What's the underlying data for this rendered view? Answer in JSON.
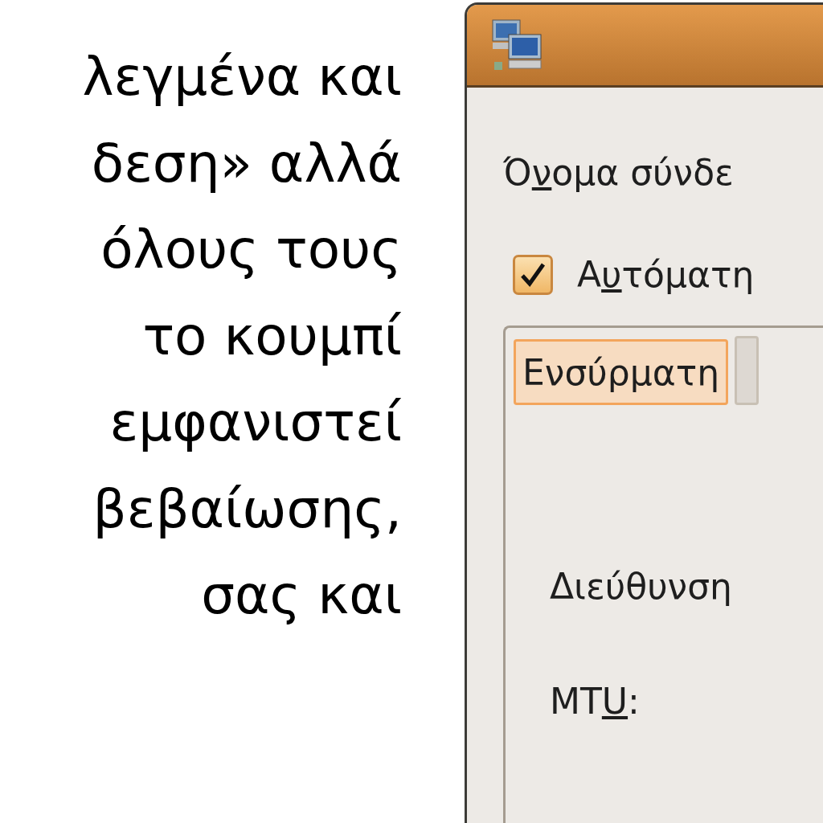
{
  "document_text": {
    "lines": [
      "λεγμένα και",
      "δεση» αλλά",
      "όλους τους",
      "το κουμπί",
      "εμφανιστεί",
      "βεβαίωσης,",
      "σας και"
    ]
  },
  "dialog": {
    "connection_name": {
      "pre": "Ό",
      "key": "ν",
      "post": "ομα σύνδε"
    },
    "auto_connect": {
      "pre": "Α",
      "key": "υ",
      "post": "τόματη",
      "checked": true
    },
    "tabs": [
      {
        "label": "Ενσύρματη",
        "selected": true
      },
      {
        "selected": false
      }
    ],
    "fields": [
      {
        "pre": "Διεύθυνση "
      },
      {
        "pre": "MT",
        "key": "U",
        "post": ":"
      }
    ]
  }
}
